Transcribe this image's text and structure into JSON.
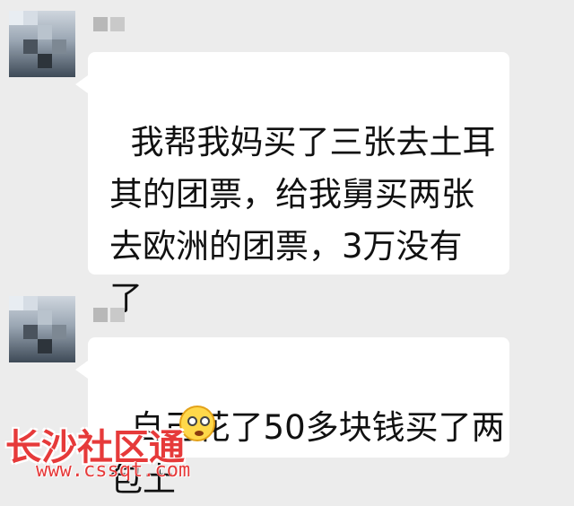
{
  "messages": [
    {
      "sender": "",
      "text": "我帮我妈买了三张去土耳\n其的团票，给我舅买两张\n去欧洲的团票，3万没有\n了"
    },
    {
      "sender": "",
      "text": "自己花了50多块钱买了两\n包土"
    }
  ],
  "emoji": "smiling-face-emoji",
  "watermark": {
    "title": "长沙社区通",
    "url": "www.cssqt.com"
  }
}
